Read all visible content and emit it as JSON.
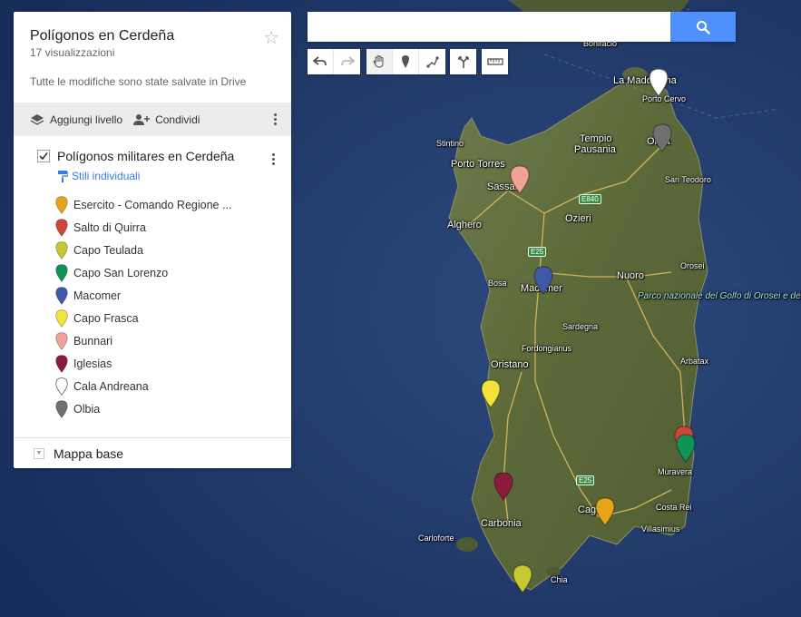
{
  "panel": {
    "title": "Polígonos en Cerdeña",
    "views": "17 visualizzazioni",
    "saved": "Tutte le modifiche sono state salvate in Drive",
    "toolbar": {
      "add_layer": "Aggiungi livello",
      "share": "Condividi"
    },
    "layer": {
      "name": "Polígonos militares en Cerdeña",
      "styles": "Stili individuali",
      "items": [
        {
          "label": "Esercito - Comando Regione ...",
          "color": "#e6a519"
        },
        {
          "label": "Salto di Quirra",
          "color": "#d0453a"
        },
        {
          "label": "Capo Teulada",
          "color": "#c6c932"
        },
        {
          "label": "Capo San Lorenzo",
          "color": "#109455"
        },
        {
          "label": "Macomer",
          "color": "#3f58a8"
        },
        {
          "label": "Capo Frasca",
          "color": "#f2e23a"
        },
        {
          "label": "Bunnari",
          "color": "#f0a295"
        },
        {
          "label": "Iglesias",
          "color": "#8c1a3b"
        },
        {
          "label": "Cala Andreana",
          "color": "#ffffff"
        },
        {
          "label": "Olbia",
          "color": "#707070"
        }
      ]
    },
    "base_map": "Mappa base"
  },
  "search": {
    "placeholder": ""
  },
  "map": {
    "places": [
      {
        "name": "Bonifacio",
        "small": true
      },
      {
        "name": "La Maddalena"
      },
      {
        "name": "Porto Cervo",
        "small": true
      },
      {
        "name": "Stintino",
        "small": true
      },
      {
        "name": "Tempio"
      },
      {
        "name": "Pausania"
      },
      {
        "name": "Olbia"
      },
      {
        "name": "Porto Torres"
      },
      {
        "name": "Sassari"
      },
      {
        "name": "San Teodoro",
        "small": true
      },
      {
        "name": "Ozieri"
      },
      {
        "name": "Alghero"
      },
      {
        "name": "Bosa",
        "small": true
      },
      {
        "name": "Macomer"
      },
      {
        "name": "Nuoro"
      },
      {
        "name": "Orosei",
        "small": true
      },
      {
        "name": "Sardegna",
        "small": true
      },
      {
        "name": "Fordongianus",
        "small": true
      },
      {
        "name": "Oristano"
      },
      {
        "name": "Arbatax",
        "small": true
      },
      {
        "name": "Muravera",
        "small": true
      },
      {
        "name": "Carbonia"
      },
      {
        "name": "Cagliari"
      },
      {
        "name": "Costa Rei",
        "small": true
      },
      {
        "name": "Villasimius",
        "small": true
      },
      {
        "name": "Carloforte",
        "small": true
      },
      {
        "name": "Chia",
        "small": true
      }
    ],
    "park": "Parco nazionale del Golfo di Orosei e del",
    "roads": [
      "E840",
      "E25",
      "E25"
    ],
    "markers": [
      {
        "name": "Cala Andreana",
        "color": "#ffffff"
      },
      {
        "name": "Olbia",
        "color": "#707070"
      },
      {
        "name": "Bunnari",
        "color": "#f0a295"
      },
      {
        "name": "Macomer",
        "color": "#3f58a8"
      },
      {
        "name": "Capo Frasca",
        "color": "#f2e23a"
      },
      {
        "name": "Salto di Quirra",
        "color": "#d0453a"
      },
      {
        "name": "Capo San Lorenzo",
        "color": "#109455"
      },
      {
        "name": "Iglesias",
        "color": "#8c1a3b"
      },
      {
        "name": "Esercito - Comando Regione",
        "color": "#e6a519"
      },
      {
        "name": "Capo Teulada",
        "color": "#c6c932"
      }
    ]
  }
}
